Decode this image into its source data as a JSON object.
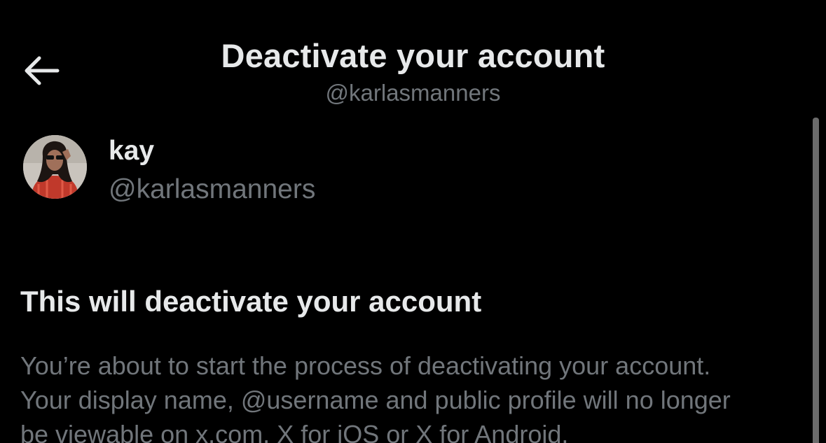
{
  "header": {
    "title": "Deactivate your account",
    "subtitle": "@karlasmanners",
    "back_icon": "arrow-left-icon"
  },
  "profile": {
    "display_name": "kay",
    "handle": "@karlasmanners",
    "avatar_icon": "profile-photo"
  },
  "section": {
    "heading": "This will deactivate your account",
    "body_lines": [
      "You’re about to start the process of deactivating your account.",
      "Your display name, @username and public profile will no longer",
      "be viewable on x.com, X for iOS or X for Android."
    ]
  },
  "colors": {
    "background": "#000000",
    "primary_text": "#e7e9ea",
    "secondary_text": "#71767b"
  }
}
